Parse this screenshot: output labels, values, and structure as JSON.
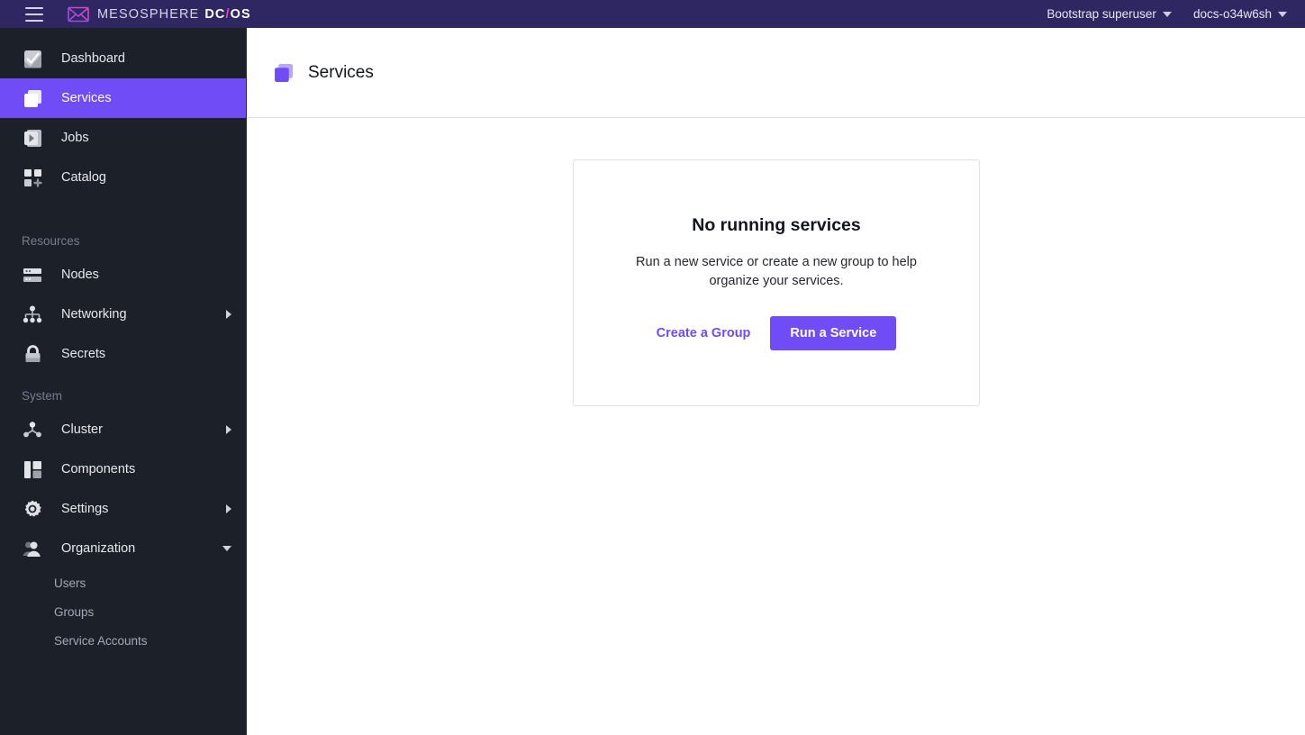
{
  "header": {
    "menu_icon": "hamburger-icon",
    "brand": {
      "logo_icon": "mesosphere-logo-icon",
      "name": "MESOSPHERE",
      "product": "DC",
      "slash": "/",
      "product_suffix": "OS"
    },
    "user_menu": "Bootstrap superuser",
    "cluster_menu": "docs-o34w6sh"
  },
  "sidebar": {
    "primary_items": [
      {
        "label": "Dashboard",
        "icon": "dashboard-icon",
        "active": false
      },
      {
        "label": "Services",
        "icon": "services-icon",
        "active": true
      },
      {
        "label": "Jobs",
        "icon": "jobs-icon",
        "active": false
      },
      {
        "label": "Catalog",
        "icon": "catalog-icon",
        "active": false
      }
    ],
    "sections": [
      {
        "label": "Resources",
        "items": [
          {
            "label": "Nodes",
            "icon": "nodes-icon",
            "expandable": false
          },
          {
            "label": "Networking",
            "icon": "networking-icon",
            "expandable": true,
            "expanded": false
          },
          {
            "label": "Secrets",
            "icon": "secrets-icon",
            "expandable": false
          }
        ]
      },
      {
        "label": "System",
        "items": [
          {
            "label": "Cluster",
            "icon": "cluster-icon",
            "expandable": true,
            "expanded": false
          },
          {
            "label": "Components",
            "icon": "components-icon",
            "expandable": false
          },
          {
            "label": "Settings",
            "icon": "settings-icon",
            "expandable": true,
            "expanded": false
          },
          {
            "label": "Organization",
            "icon": "organization-icon",
            "expandable": true,
            "expanded": true
          }
        ]
      }
    ],
    "organization_children": [
      {
        "label": "Users"
      },
      {
        "label": "Groups"
      },
      {
        "label": "Service Accounts"
      }
    ]
  },
  "page": {
    "icon": "services-page-icon",
    "title": "Services"
  },
  "empty_state": {
    "title": "No running services",
    "description": "Run a new service or create a new group to help organize your services.",
    "secondary_action": "Create a Group",
    "primary_action": "Run a Service"
  },
  "colors": {
    "accent": "#6f4cf5",
    "header_bg": "#2e2761",
    "sidebar_bg": "#1c2029",
    "logo_pink": "#e048c0"
  }
}
